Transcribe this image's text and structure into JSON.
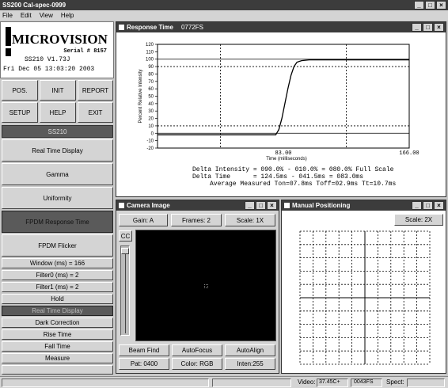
{
  "app": {
    "title": "SS200 Cal-spec-0999"
  },
  "menu": [
    "File",
    "Edit",
    "View",
    "Help"
  ],
  "brand": {
    "logo": "MICROVISION",
    "serial": "Serial # 8157",
    "version": "SS210 V1.73J",
    "datetime": "Fri Dec 05 13:03:20 2003"
  },
  "controls": {
    "pos": "POS.",
    "init": "INIT",
    "report": "REPORT",
    "setup": "SETUP",
    "help": "HELP",
    "exit": "EXIT"
  },
  "sidebar": {
    "header": "SS210",
    "big_buttons": [
      "Real Time Display",
      "Gamma",
      "Uniformity",
      "FPDM Response Time",
      "FPDM Flicker"
    ],
    "small_buttons": [
      "Window (ms) = 166",
      "Filter0 (ms) = 2",
      "Filter1 (ms) = 2",
      "Hold",
      "Real Time Display",
      "Dark Correction",
      "Rise Time",
      "Fall Time",
      "Measure"
    ]
  },
  "response": {
    "title": "Response Time",
    "title_code": "0772FS",
    "ylabel": "Percent Relative Intensity",
    "xlabel": "Time (milliseconds)",
    "line1": "Delta Intensity = 090.0% - 010.0% = 080.0% Full Scale",
    "line2": "Delta Time      = 124.5ms - 041.5ms = 083.0ms",
    "line3": "Average Measured Ton=07.8ms Toff=02.9ms Tt=10.7ms"
  },
  "chart_data": {
    "type": "line",
    "xlim": [
      0,
      166
    ],
    "ylim": [
      -20,
      120
    ],
    "yticks": [
      -20,
      -10,
      0,
      10,
      20,
      30,
      40,
      50,
      60,
      70,
      80,
      90,
      100,
      110,
      120
    ],
    "xtick_labels": [
      "83.00",
      "166.00"
    ],
    "hlines": [
      0,
      10,
      90,
      100
    ],
    "vlines": [
      41.5,
      124.5
    ],
    "series": [
      {
        "x": [
          0,
          20,
          40,
          60,
          70,
          75,
          78,
          80,
          82,
          84,
          86,
          88,
          90,
          92,
          95,
          100,
          120,
          140,
          166
        ],
        "values": [
          -2,
          -2,
          -2,
          -2,
          -2,
          -2,
          -2,
          5,
          20,
          40,
          60,
          78,
          90,
          96,
          98,
          99,
          99,
          99,
          99
        ]
      }
    ]
  },
  "camera": {
    "title": "Camera Image",
    "gain": "Gain: A",
    "frames": "Frames: 2",
    "scale": "Scale: 1X",
    "cc": "CC",
    "beam_find": "Beam Find",
    "autofocus": "AutoFocus",
    "autoalign": "AutoAlign",
    "pat": "Pat: 0400",
    "color": "Color: RGB",
    "inten": "Inten:255"
  },
  "manual": {
    "title": "Manual Positioning",
    "scale": "Scale: 2X"
  },
  "status": {
    "video_label": "Video:",
    "video_value": "37.45C+",
    "code": "0043FS",
    "spect_label": "Spect:"
  }
}
